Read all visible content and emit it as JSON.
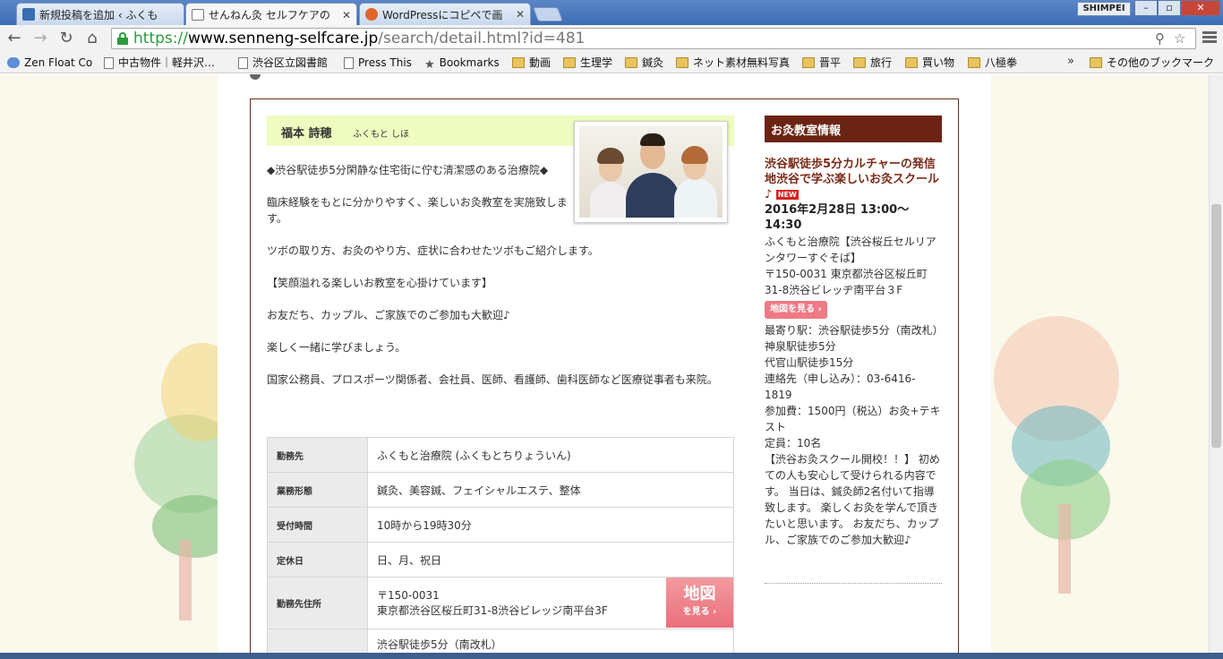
{
  "browser": {
    "tabs": [
      {
        "title": "新規投稿を追加 ‹ ふくも"
      },
      {
        "title": "せんねん灸 セルフケアの"
      },
      {
        "title": "WordPressにコピペで画"
      }
    ],
    "close_glyph": "✕",
    "user": "SHIMPEI",
    "url_scheme": "https://",
    "url_host": "www.senneng-selfcare.jp",
    "url_path": "/search/detail.html?id=481",
    "bookmarks": [
      "Zen Float Co",
      "中古物件｜軽井沢…",
      "渋谷区立図書館",
      "Press This",
      "Bookmarks",
      "動画",
      "生理学",
      "鍼灸",
      "ネット素材無料写真",
      "晋平",
      "旅行",
      "買い物",
      "八極拳"
    ],
    "bookmarks_more": "»",
    "other_bookmarks": "その他のブックマーク"
  },
  "profile": {
    "name": "福本 詩穂",
    "kana": "ふくもと しほ",
    "intro": [
      "◆渋谷駅徒歩5分閑静な住宅街に佇む清潔感のある治療院◆",
      "臨床経験をもとに分かりやすく、楽しいお灸教室を実施致します。",
      "ツボの取り方、お灸のやり方、症状に合わせたツボもご紹介します。",
      "【笑顔溢れる楽しいお教室を心掛けています】",
      "お友だち、カップル、ご家族でのご参加も大歓迎♪",
      "楽しく一緒に学びましょう。",
      "国家公務員、プロスポーツ関係者、会社員、医師、看護師、歯科医師など医療従事者も来院。"
    ]
  },
  "info_table": {
    "rows": [
      {
        "label": "勤務先",
        "value": "ふくもと治療院 (ふくもとちりょういん)"
      },
      {
        "label": "業務形態",
        "value": "鍼灸、美容鍼、フェイシャルエステ、整体"
      },
      {
        "label": "受付時間",
        "value": "10時から19時30分"
      },
      {
        "label": "定休日",
        "value": "日、月、祝日"
      }
    ],
    "address_label": "勤務先住所",
    "postal": "〒150-0031",
    "address": "東京都渋谷区桜丘町31-8渋谷ビレッジ南平台3F",
    "map_big": "地図",
    "map_small": "を見る",
    "access": "渋谷駅徒歩5分（南改札）"
  },
  "sidebar": {
    "heading": "お灸教室情報",
    "event_title": "渋谷駅徒歩5分カルチャーの発信地渋谷で学ぶ楽しいお灸スクール♪",
    "new_badge": "NEW",
    "event_date": "2016年2月28日 13:00～14:30",
    "venue": "ふくもと治療院【渋谷桜丘セルリアンタワーすぐそば】",
    "address": "〒150-0031 東京都渋谷区桜丘町31-8渋谷ビレッヂ南平台３F",
    "map_button": "地図を見る",
    "station1": "最寄り駅：渋谷駅徒歩5分（南改札）",
    "station2": "神泉駅徒歩5分",
    "station3": "代官山駅徒歩15分",
    "contact": "連絡先（申し込み）：03-6416-1819",
    "fee": "参加費：1500円（税込）お灸+テキスト",
    "capacity": "定員：10名",
    "notes": "【渋谷お灸スクール開校！！】 初めての人も安心して受けられる内容です。 当日は、鍼灸師2名付いて指導致します。 楽しくお灸を学んで頂きたいと思います。 お友だち、カップル、ご家族でのご参加大歓迎♪"
  },
  "colors": {
    "accent_brown": "#6b2414",
    "name_bar": "#eefcc0",
    "map_pink": "#ea6f7a",
    "url_green": "#2a9b3b"
  }
}
